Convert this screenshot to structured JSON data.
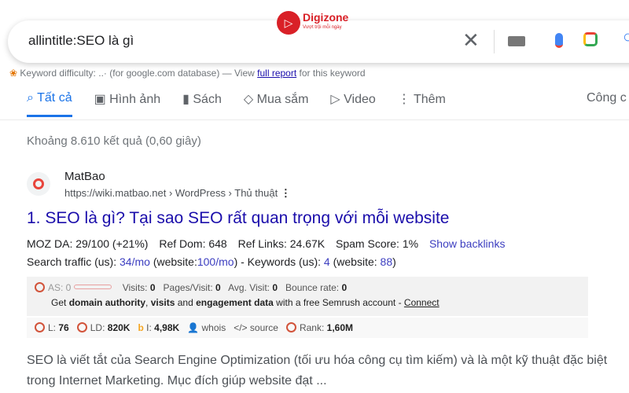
{
  "search": {
    "query": "allintitle:SEO là gì"
  },
  "logo": {
    "name": "Digizone",
    "slogan": "Vượt trội mỗi ngày"
  },
  "keyword": {
    "prefix": "Keyword difficulty:",
    "dots": "..·",
    "mid": "(for google.com database) — View",
    "link": "full report",
    "suffix": "for this keyword"
  },
  "tabs": [
    {
      "label": "Tất cả",
      "icon": "search-icon"
    },
    {
      "label": "Hình ảnh",
      "icon": "image-icon"
    },
    {
      "label": "Sách",
      "icon": "book-icon"
    },
    {
      "label": "Mua sắm",
      "icon": "tag-icon"
    },
    {
      "label": "Video",
      "icon": "play-icon"
    },
    {
      "label": "Thêm",
      "icon": "more-icon"
    }
  ],
  "tools": "Công c",
  "stats": "Khoảng 8.610 kết quả (0,60 giây)",
  "result": {
    "site": "MatBao",
    "url": "https://wiki.matbao.net › WordPress › Thủ thuật",
    "title": "1. SEO là gì? Tại sao SEO rất quan trọng với mỗi website",
    "moz": "MOZ DA: 29/100 (+21%)",
    "refdom": "Ref Dom: 648",
    "reflinks": "Ref Links: 24.67K",
    "spam": "Spam Score: 1%",
    "backlinks": "Show backlinks",
    "traffic": {
      "a": "Search traffic (us):",
      "b": "34/mo",
      "c": "(website:",
      "d": "100/mo",
      "e": ") - Keywords (us):",
      "f": "4",
      "g": "(website:",
      "h": "88",
      "i": ")"
    },
    "semrush": {
      "as": "AS: 0",
      "visits_l": "Visits:",
      "visits": "0",
      "pv_l": "Pages/Visit:",
      "pv": "0",
      "av_l": "Avg. Visit:",
      "av": "0",
      "br_l": "Bounce rate:",
      "br": "0",
      "promo1": "Get",
      "promo2": "domain authority",
      "promo3": ",",
      "promo4": "visits",
      "promo5": "and",
      "promo6": "engagement data",
      "promo7": "with a free Semrush account -",
      "connect": "Connect"
    },
    "seoquake": {
      "l_l": "L:",
      "l": "76",
      "ld_l": "LD:",
      "ld": "820K",
      "i_l": "I:",
      "i": "4,98K",
      "whois": "whois",
      "source": "source",
      "rank_l": "Rank:",
      "rank": "1,60M"
    },
    "snippet": "SEO là viết tắt của Search Engine Optimization (tối ưu hóa công cụ tìm kiếm) và là một kỹ thuật đặc biệt trong Internet Marketing. Mục đích giúp website đạt ..."
  }
}
